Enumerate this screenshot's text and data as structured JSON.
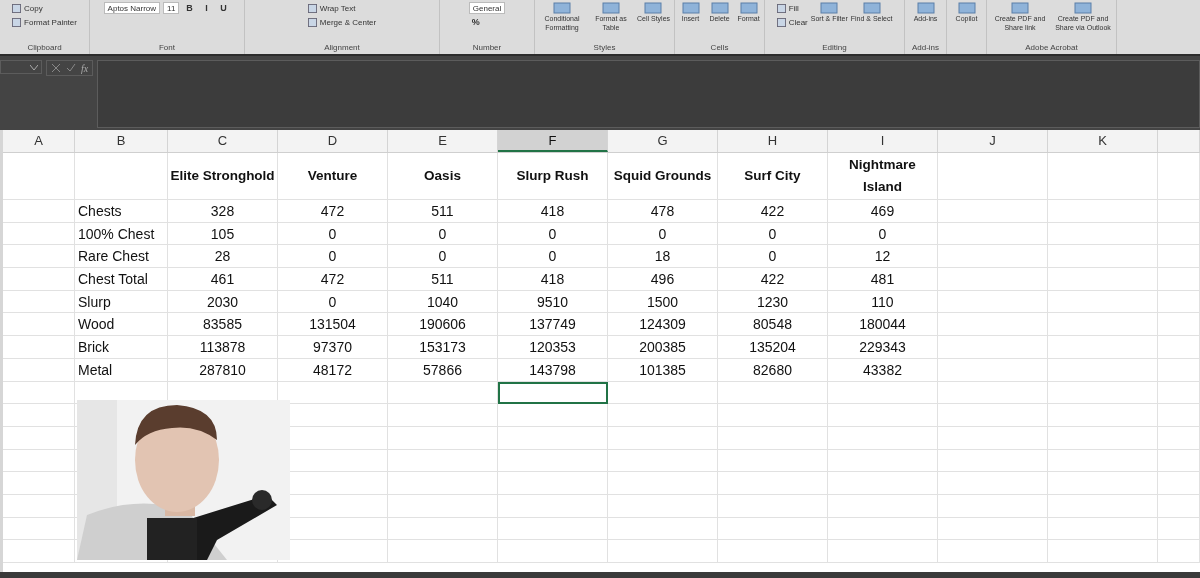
{
  "ribbon": {
    "groups": [
      {
        "label": "Clipboard",
        "items": [
          {
            "kind": "small",
            "label": "Copy"
          },
          {
            "kind": "small",
            "label": "Format Painter"
          }
        ]
      },
      {
        "label": "Font",
        "items": [
          {
            "kind": "field",
            "label": "Aptos Narrow"
          },
          {
            "kind": "field",
            "label": "11"
          },
          {
            "kind": "toggle",
            "label": "B"
          },
          {
            "kind": "toggle",
            "label": "I"
          },
          {
            "kind": "toggle",
            "label": "U"
          }
        ]
      },
      {
        "label": "Alignment",
        "items": [
          {
            "kind": "small",
            "label": "Wrap Text"
          },
          {
            "kind": "small",
            "label": "Merge & Center"
          }
        ]
      },
      {
        "label": "Number",
        "items": [
          {
            "kind": "field",
            "label": "General"
          },
          {
            "kind": "symbol",
            "label": "%"
          }
        ]
      },
      {
        "label": "Styles",
        "items": [
          {
            "kind": "large",
            "label": "Conditional Formatting"
          },
          {
            "kind": "large",
            "label": "Format as Table"
          },
          {
            "kind": "large",
            "label": "Cell Styles"
          }
        ]
      },
      {
        "label": "Cells",
        "items": [
          {
            "kind": "large",
            "label": "Insert"
          },
          {
            "kind": "large",
            "label": "Delete"
          },
          {
            "kind": "large",
            "label": "Format"
          }
        ]
      },
      {
        "label": "Editing",
        "items": [
          {
            "kind": "small",
            "label": "Fill"
          },
          {
            "kind": "small",
            "label": "Clear"
          },
          {
            "kind": "large",
            "label": "Sort & Filter"
          },
          {
            "kind": "large",
            "label": "Find & Select"
          }
        ]
      },
      {
        "label": "Add-ins",
        "items": [
          {
            "kind": "large",
            "label": "Add-ins"
          }
        ]
      },
      {
        "items": [
          {
            "kind": "large",
            "label": "Copilot"
          }
        ]
      },
      {
        "label": "Adobe Acrobat",
        "items": [
          {
            "kind": "large",
            "label": "Create PDF and Share link"
          },
          {
            "kind": "large",
            "label": "Create PDF and Share via Outlook"
          }
        ]
      }
    ]
  },
  "formula_bar": {
    "fx": "fx"
  },
  "columns": [
    {
      "letter": "A",
      "selected": false
    },
    {
      "letter": "B",
      "selected": false
    },
    {
      "letter": "C",
      "selected": false
    },
    {
      "letter": "D",
      "selected": false
    },
    {
      "letter": "E",
      "selected": false
    },
    {
      "letter": "F",
      "selected": true
    },
    {
      "letter": "G",
      "selected": false
    },
    {
      "letter": "H",
      "selected": false
    },
    {
      "letter": "I",
      "selected": false
    },
    {
      "letter": "J",
      "selected": false
    },
    {
      "letter": "K",
      "selected": false
    }
  ],
  "header_row": [
    "Elite Stronghold",
    "Venture",
    "Oasis",
    "Slurp Rush",
    "Squid Grounds",
    "Surf City",
    "Nightmare Island"
  ],
  "rows": [
    {
      "label": "Chests",
      "values": [
        "328",
        "472",
        "511",
        "418",
        "478",
        "422",
        "469"
      ]
    },
    {
      "label": "100% Chest",
      "values": [
        "105",
        "0",
        "0",
        "0",
        "0",
        "0",
        "0"
      ]
    },
    {
      "label": "Rare Chest",
      "values": [
        "28",
        "0",
        "0",
        "0",
        "18",
        "0",
        "12"
      ]
    },
    {
      "label": "Chest Total",
      "values": [
        "461",
        "472",
        "511",
        "418",
        "496",
        "422",
        "481"
      ]
    },
    {
      "label": "Slurp",
      "values": [
        "2030",
        "0",
        "1040",
        "9510",
        "1500",
        "1230",
        "110"
      ]
    },
    {
      "label": "Wood",
      "values": [
        "83585",
        "131504",
        "190606",
        "137749",
        "124309",
        "80548",
        "180044"
      ]
    },
    {
      "label": "Brick",
      "values": [
        "113878",
        "97370",
        "153173",
        "120353",
        "200385",
        "135204",
        "229343"
      ]
    },
    {
      "label": "Metal",
      "values": [
        "287810",
        "48172",
        "57866",
        "143798",
        "101385",
        "82680",
        "43382"
      ]
    }
  ],
  "blank_rows": [
    {
      "selected": true
    },
    {
      "selected": false
    },
    {
      "selected": false
    },
    {
      "selected": false
    },
    {
      "selected": false
    },
    {
      "selected": false
    },
    {
      "selected": false
    },
    {
      "selected": false
    }
  ],
  "webcam": {
    "kind": "picture"
  }
}
